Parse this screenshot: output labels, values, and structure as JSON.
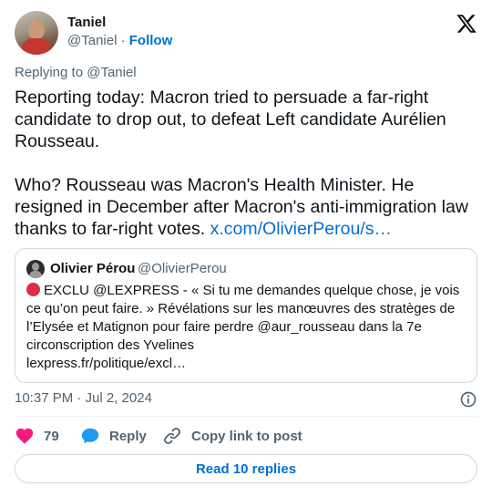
{
  "author": {
    "name": "Taniel",
    "handle": "@Taniel",
    "separator": " · ",
    "follow_label": "Follow"
  },
  "replying_to": {
    "prefix": "Replying to ",
    "handle": "@Taniel"
  },
  "tweet": {
    "text": "Reporting today: Macron tried to persuade a far-right candidate to drop out, to defeat Left candidate Aurélien Rousseau.\n\nWho? Rousseau was Macron's Health Minister. He resigned in December after Macron's anti-immigration law thanks to far-right votes. ",
    "link": "x.com/OlivierPerou/s…",
    "timestamp": "10:37 PM · Jul 2, 2024"
  },
  "quote": {
    "name": "Olivier Pérou",
    "handle": "@OlivierPerou",
    "text": "EXCLU @LEXPRESS - « Si tu me demandes quelque chose, je vois ce qu’on peut faire. » Révélations sur les manœuvres des stratèges de l’Elysée et Matignon pour faire perdre @aur_rousseau dans la 7e circonscription des Yvelines",
    "link": "lexpress.fr/politique/excl…"
  },
  "actions": {
    "like_count": "79",
    "reply_label": "Reply",
    "copy_label": "Copy link to post"
  },
  "read_replies_label": "Read 10 replies",
  "colors": {
    "link": "#006fd6",
    "muted": "#536471",
    "heart": "#f91880",
    "reply_bubble": "#1d9bf0",
    "red_dot": "#dd2e44"
  },
  "icons": {
    "logo": "x-logo-icon",
    "info": "info-icon",
    "like": "heart-icon",
    "reply": "speech-bubble-icon",
    "copy": "link-icon"
  }
}
